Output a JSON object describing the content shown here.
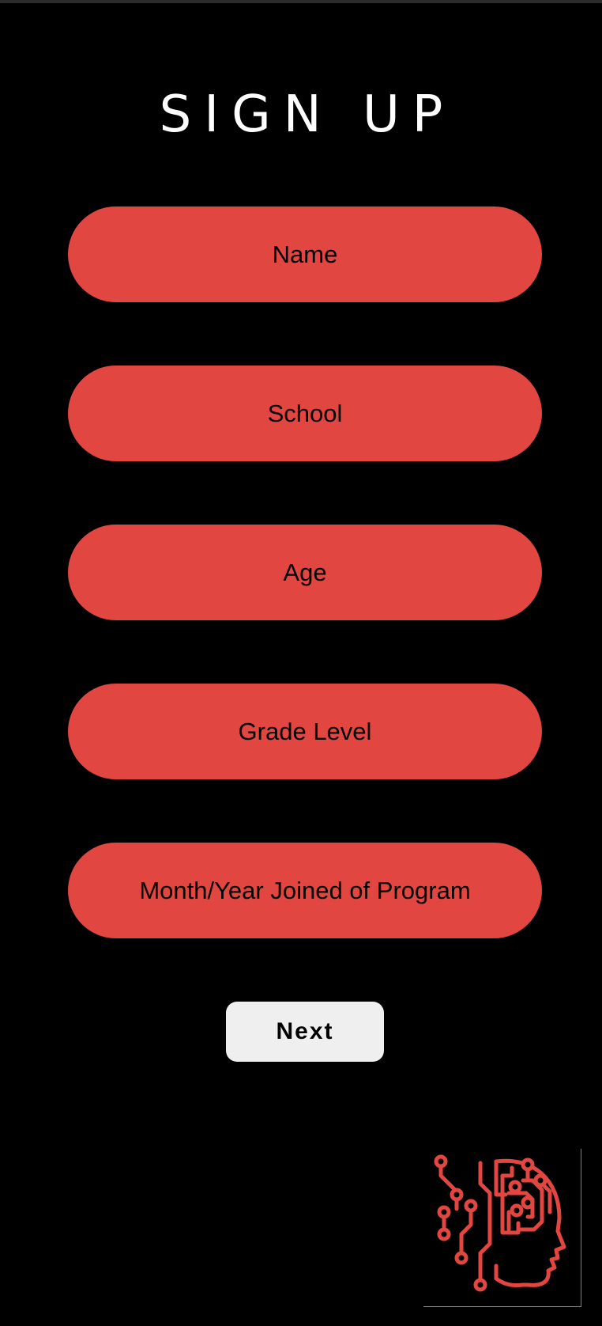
{
  "title": "SIGN UP",
  "fields": [
    {
      "label": "Name"
    },
    {
      "label": "School"
    },
    {
      "label": "Age"
    },
    {
      "label": "Grade Level"
    },
    {
      "label": "Month/Year Joined of Program"
    }
  ],
  "actions": {
    "next_label": "Next"
  },
  "logo": {
    "icon": "ai-brain-circuit-icon"
  },
  "colors": {
    "background": "#000000",
    "field": "#e24640",
    "button": "#efefef",
    "frame": "#7f74c9"
  }
}
